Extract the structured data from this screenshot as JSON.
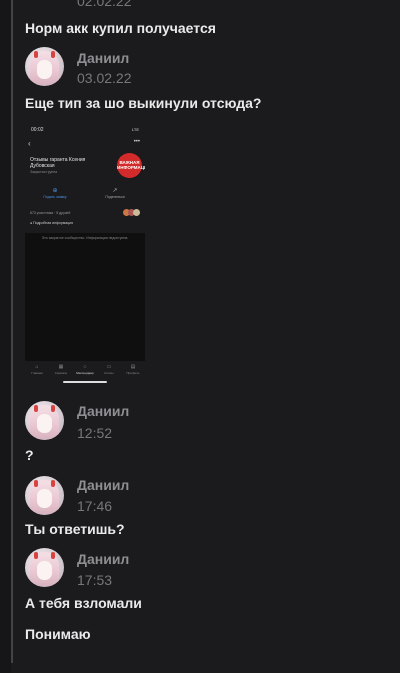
{
  "feed": {
    "top_message": {
      "date": "02.02.22",
      "text": "Норм акк купил получается"
    },
    "message_1": {
      "author": "Даниил",
      "time": "03.02.22",
      "text": "Еще тип за шо выкинули отсюда?"
    },
    "screenshot": {
      "status_time": "00:02",
      "status_right": "LTE",
      "back_icon": "chevron-left-icon",
      "group_name": "Отзывы гаранта Ксения Дубовская",
      "group_sub": "Закрытая группа",
      "logo_text": "ВАЖНАЯ ИНФОРМАЦИЯ",
      "action_1": "Подать заявку",
      "action_2": "Поделиться",
      "members": "873 участника · 5 друзей",
      "info": "Подробная информация",
      "closed_text": "Это закрытое сообщество. Информация недоступна.",
      "tabs": [
        "Главная",
        "Сервисы",
        "Мессенджер",
        "Клипы",
        "Профиль"
      ]
    },
    "message_2": {
      "author": "Даниил",
      "time": "12:52",
      "text": "?"
    },
    "message_3": {
      "author": "Даниил",
      "time": "17:46",
      "text": "Ты ответишь?"
    },
    "message_4": {
      "author": "Даниил",
      "time": "17:53",
      "text": "А тебя взломали",
      "text2": "Понимаю"
    }
  },
  "colors": {
    "background": "#1b1b1d",
    "author": "#8e8e93",
    "timestamp": "#77777b",
    "message_text": "#eaeaea",
    "thread_line": "#444446"
  }
}
